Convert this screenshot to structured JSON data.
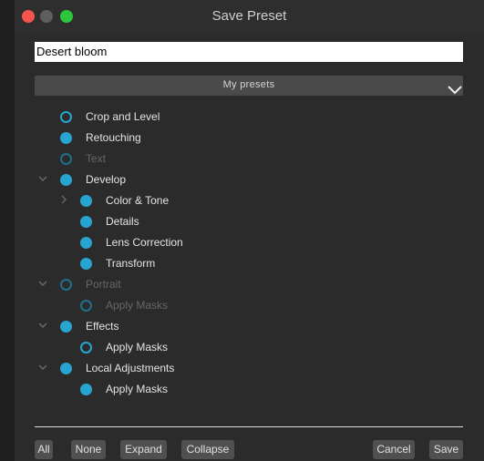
{
  "window": {
    "title": "Save Preset"
  },
  "preset_name": {
    "value": "Desert bloom"
  },
  "category_select": {
    "selected": "My presets"
  },
  "tree": {
    "items": [
      {
        "label": "Crop and Level",
        "checked": false,
        "enabled": true,
        "expander": "none"
      },
      {
        "label": "Retouching",
        "checked": true,
        "enabled": true,
        "expander": "none"
      },
      {
        "label": "Text",
        "checked": false,
        "enabled": false,
        "expander": "none"
      },
      {
        "label": "Develop",
        "checked": true,
        "enabled": true,
        "expander": "expanded"
      },
      {
        "label": "Color & Tone",
        "checked": true,
        "enabled": true,
        "expander": "collapsed"
      },
      {
        "label": "Details",
        "checked": true,
        "enabled": true,
        "expander": "none"
      },
      {
        "label": "Lens Correction",
        "checked": true,
        "enabled": true,
        "expander": "none"
      },
      {
        "label": "Transform",
        "checked": true,
        "enabled": true,
        "expander": "none"
      },
      {
        "label": "Portrait",
        "checked": false,
        "enabled": false,
        "expander": "expanded"
      },
      {
        "label": "Apply Masks",
        "checked": false,
        "enabled": false,
        "expander": "none"
      },
      {
        "label": "Effects",
        "checked": true,
        "enabled": true,
        "expander": "expanded"
      },
      {
        "label": "Apply Masks",
        "checked": false,
        "enabled": true,
        "expander": "none"
      },
      {
        "label": "Local Adjustments",
        "checked": true,
        "enabled": true,
        "expander": "expanded"
      },
      {
        "label": "Apply Masks",
        "checked": true,
        "enabled": true,
        "expander": "none"
      }
    ]
  },
  "footer": {
    "all_label": "All",
    "none_label": "None",
    "expand_label": "Expand",
    "collapse_label": "Collapse",
    "cancel_label": "Cancel",
    "save_label": "Save"
  },
  "colors": {
    "accent": "#27a4cf",
    "close": "#f4554f",
    "zoom": "#2cc63d"
  }
}
